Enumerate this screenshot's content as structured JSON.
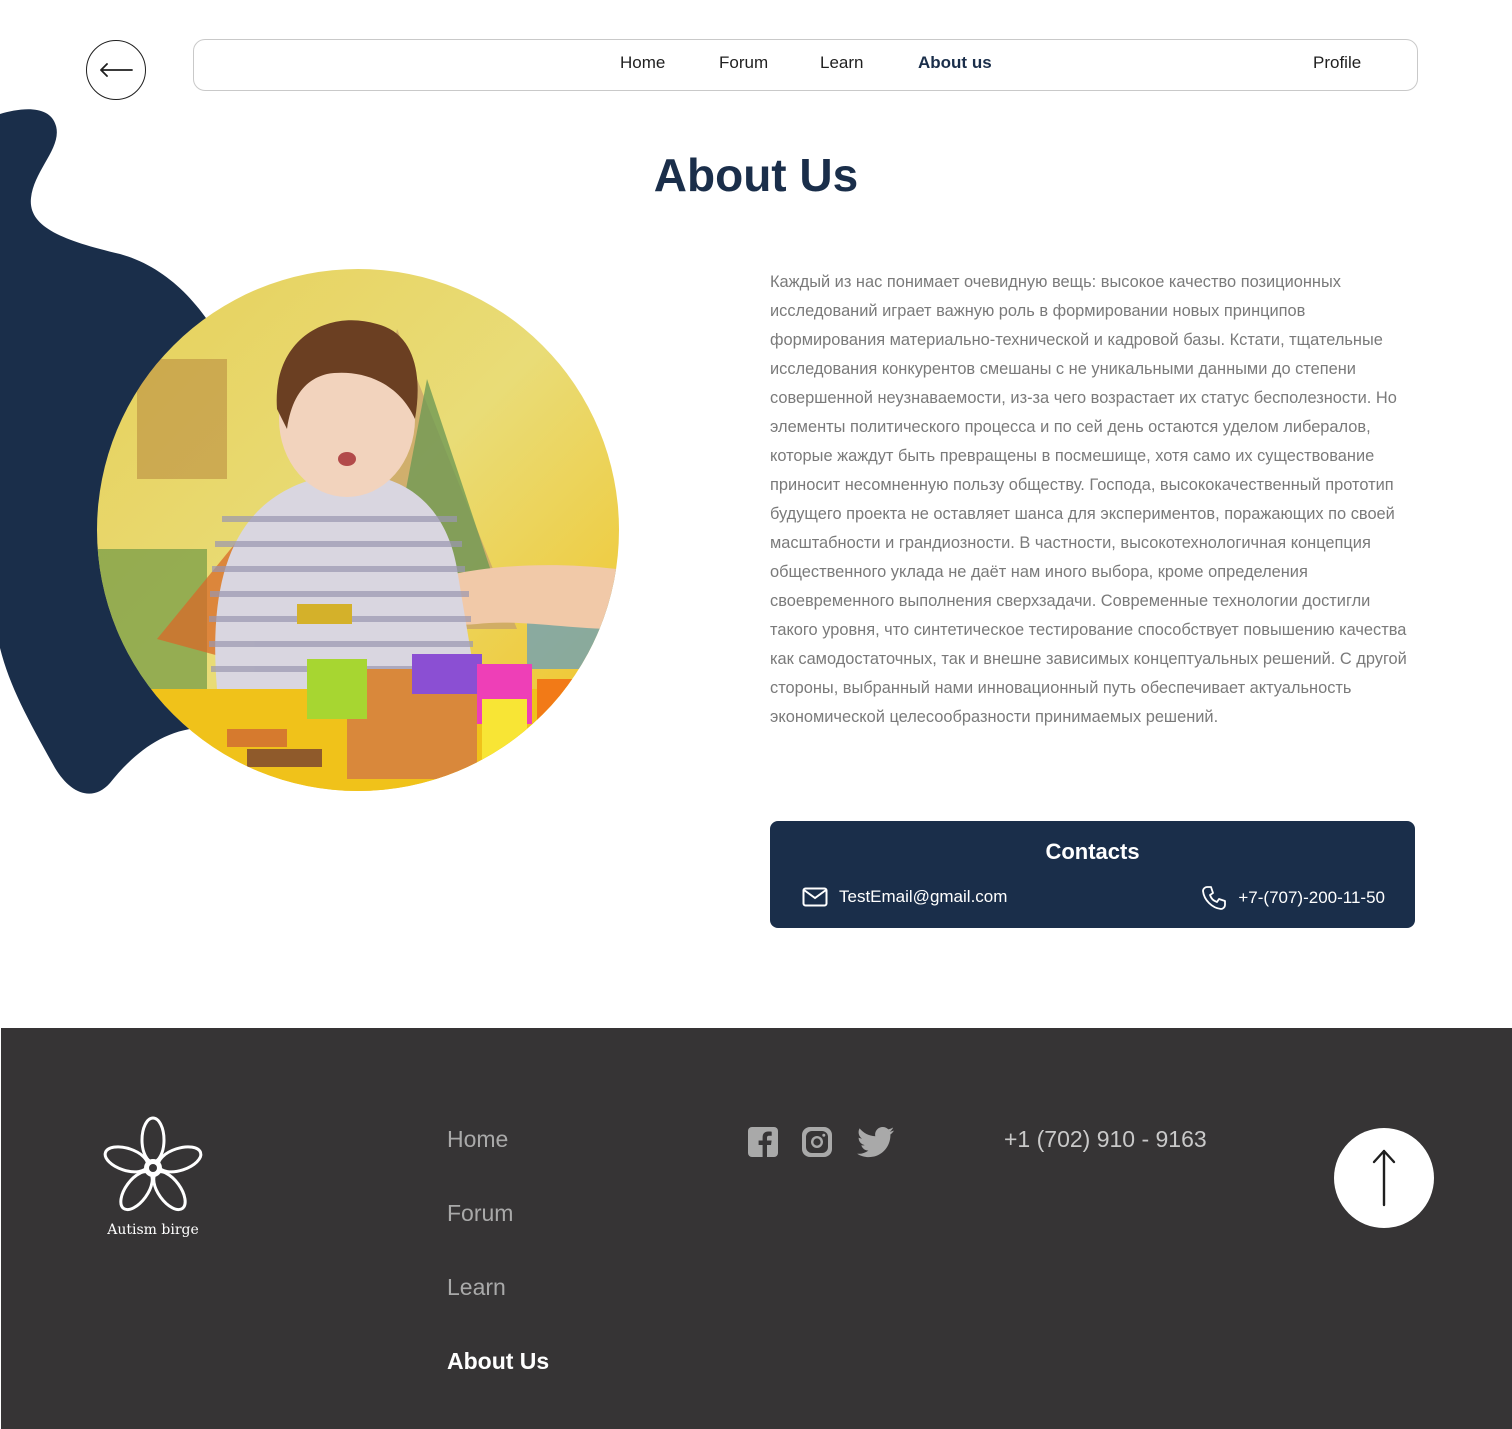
{
  "nav": {
    "items": [
      {
        "label": "Home"
      },
      {
        "label": "Forum"
      },
      {
        "label": "Learn"
      },
      {
        "label": "About us",
        "active": true
      }
    ],
    "profile": "Profile",
    "back_icon": "arrow-left-icon"
  },
  "main": {
    "title": "About Us",
    "body": "Каждый из нас понимает очевидную вещь: высокое качество позиционных исследований играет важную роль в формировании новых принципов формирования материально-технической и кадровой базы. Кстати, тщательные исследования конкурентов смешаны с не уникальными данными до степени совершенной неузнаваемости, из-за чего возрастает их статус бесполезности. Но элементы политического процесса и по сей день остаются уделом либералов, которые жаждут быть превращены в посмешище, хотя само их существование приносит несомненную пользу обществу. Господа, высококачественный прототип будущего проекта не оставляет шанса для экспериментов, поражающих по своей масштабности и грандиозности. В частности, высокотехнологичная концепция общественного уклада не даёт нам иного выбора, кроме определения своевременного выполнения сверхзадачи. Современные технологии достигли такого уровня, что синтетическое тестирование способствует повышению качества как самодостаточных, так и внешне зависимых концептуальных решений. С другой стороны, выбранный нами инновационный путь обеспечивает актуальность экономической целесообразности принимаемых решений.",
    "contacts": {
      "title": "Contacts",
      "email": "TestEmail@gmail.com",
      "phone": "+7-(707)-200-11-50",
      "email_icon": "envelope-icon",
      "phone_icon": "phone-icon"
    }
  },
  "footer": {
    "logo_text": "Autism birge",
    "nav": [
      {
        "label": "Home"
      },
      {
        "label": "Forum"
      },
      {
        "label": "Learn"
      },
      {
        "label": "About Us",
        "active": true
      }
    ],
    "social_icons": [
      "facebook-icon",
      "instagram-icon",
      "twitter-icon"
    ],
    "phone": "+1 (702) 910 - 9163",
    "scroll_top_icon": "arrow-up-icon"
  },
  "colors": {
    "navy": "#1a2e4a",
    "footer_bg": "#363435",
    "body_text": "#7a7a7a"
  }
}
